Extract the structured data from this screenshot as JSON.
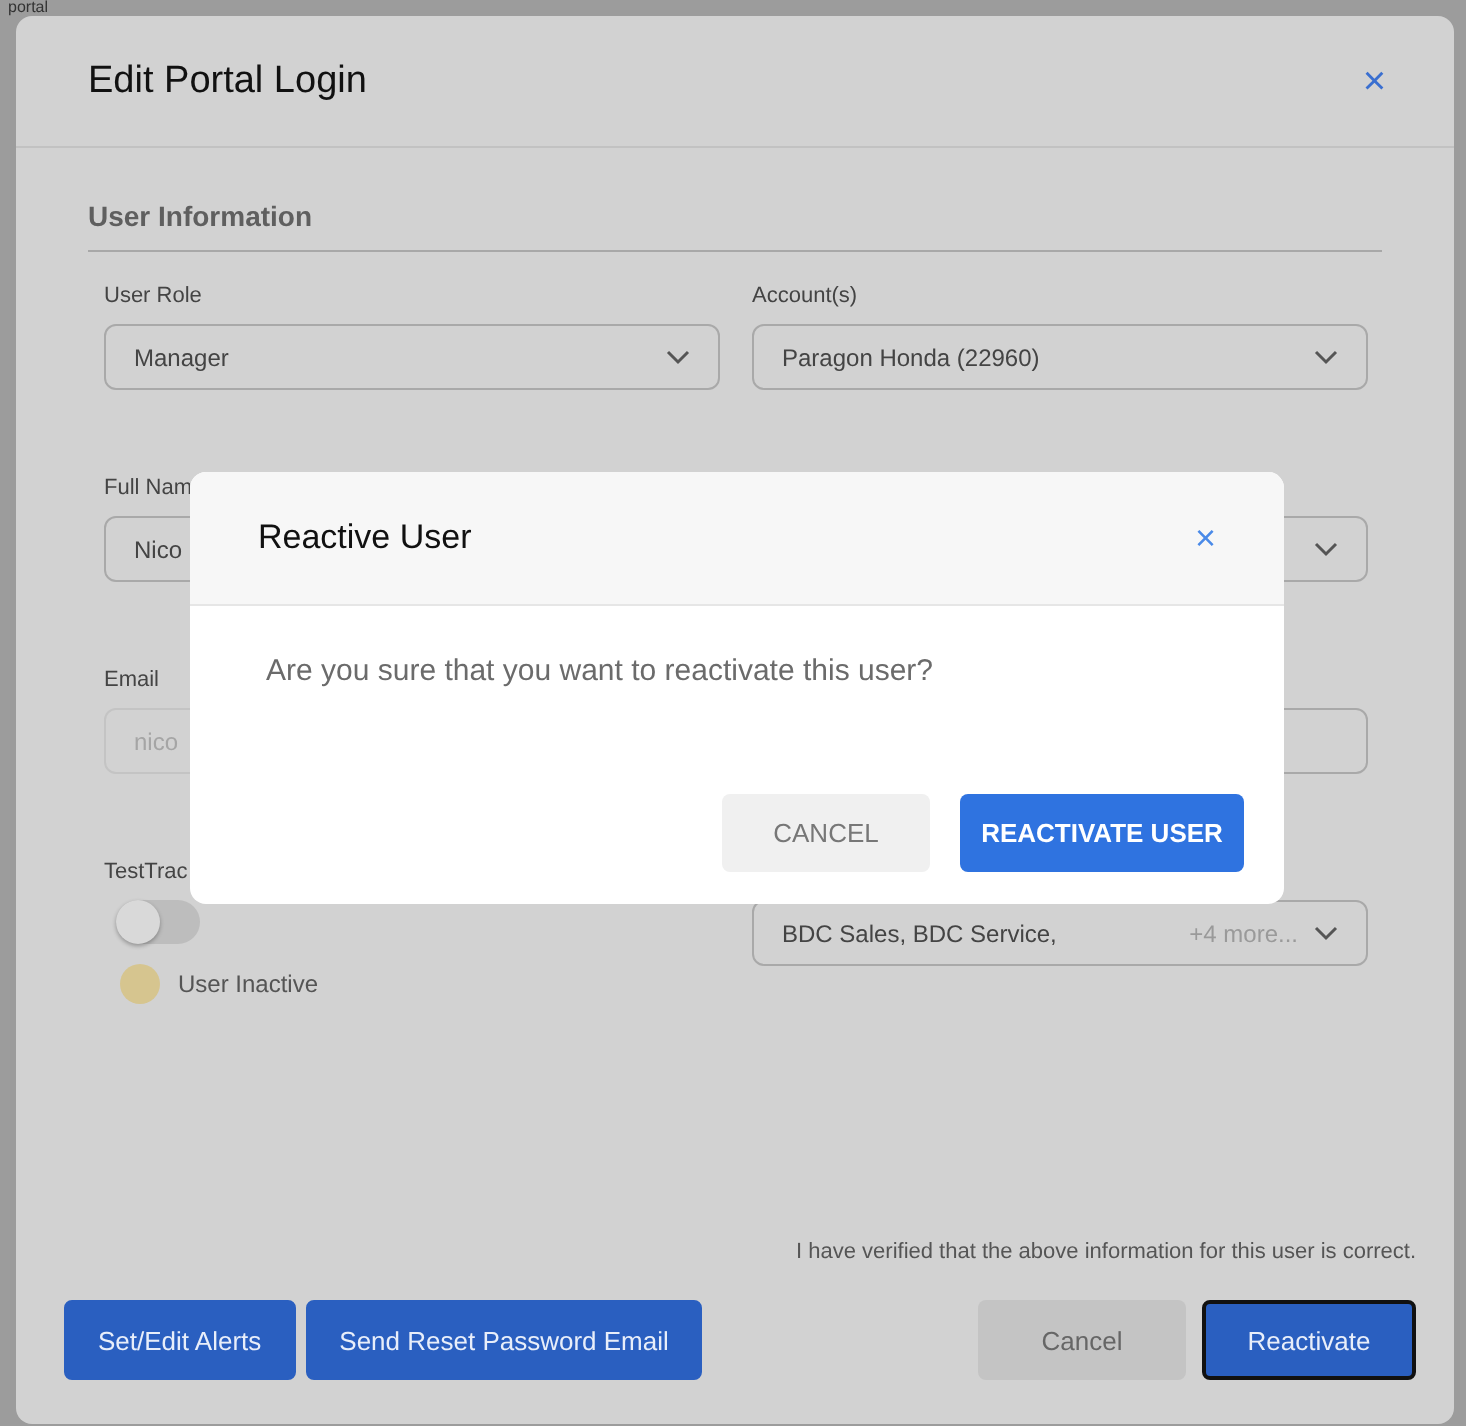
{
  "background_page": {
    "text": "portal"
  },
  "modal": {
    "title": "Edit Portal Login",
    "close": "×",
    "section": "User Information",
    "fields": [
      {
        "kind": "select",
        "label": "User Role",
        "value": "Manager"
      },
      {
        "kind": "select",
        "label": "Account(s)",
        "value": "Paragon Honda (22960)"
      },
      {
        "kind": "text",
        "label": "Full Nam",
        "value": "Nico"
      },
      {
        "kind": "select"
      },
      {
        "kind": "email",
        "label": "Email",
        "value": "nico",
        "disabled": true
      },
      {
        "kind": "text"
      },
      {
        "kind": "toggle",
        "label": "TestTrac",
        "on": false
      },
      {
        "kind": "select",
        "value": "BDC Sales, BDC Service,",
        "more": "+4 more..."
      }
    ],
    "status": {
      "label": "User Inactive",
      "color": "#d6c58f"
    },
    "verification": "I have verified that the above information for this user is correct.",
    "left_buttons": [
      "Set/Edit Alerts",
      "Send Reset Password Email"
    ],
    "cancel": "Cancel",
    "confirm": "Reactivate"
  },
  "dialog": {
    "title": "Reactive User",
    "close": "×",
    "message": "Are you sure that you want to reactivate this user?",
    "cancel": "CANCEL",
    "confirm": "REACTIVATE USER"
  }
}
